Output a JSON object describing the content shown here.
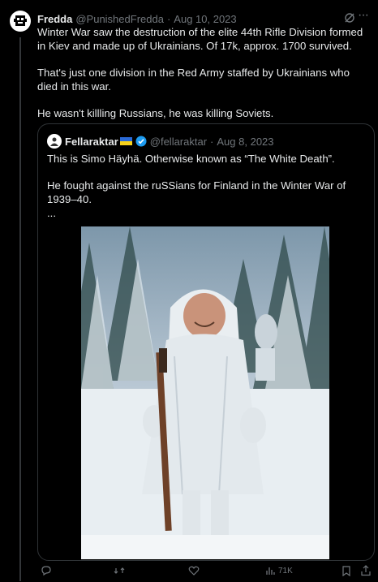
{
  "tweet": {
    "name": "Fredda",
    "handle": "@PunishedFredda",
    "dot": "·",
    "date": "Aug 10, 2023",
    "more": "···",
    "paragraphs": [
      "Winter War saw the destruction of the elite 44th Rifle Division formed in Kiev and made up of Ukrainians. Of 17k, approx. 1700 survived.",
      "That's just one division in the Red Army staffed by Ukrainians who died in this war.",
      "He wasn't killling Russians, he was killing Soviets."
    ]
  },
  "quote": {
    "name": "Fellaraktar",
    "handle": "@fellaraktar",
    "dot": "·",
    "date": "Aug 8, 2023",
    "lines": [
      "This is Simo Häyhä. Otherwise known as “The White Death”.",
      "He fought against the ruSSians for Finland in the Winter War of 1939–40.",
      "..."
    ]
  },
  "actions": {
    "views": "71K"
  },
  "colors": {
    "background": "#000000",
    "text": "#e7e9ea",
    "muted": "#71767b",
    "border": "#2f3336",
    "verified": "#1d9bf0"
  }
}
